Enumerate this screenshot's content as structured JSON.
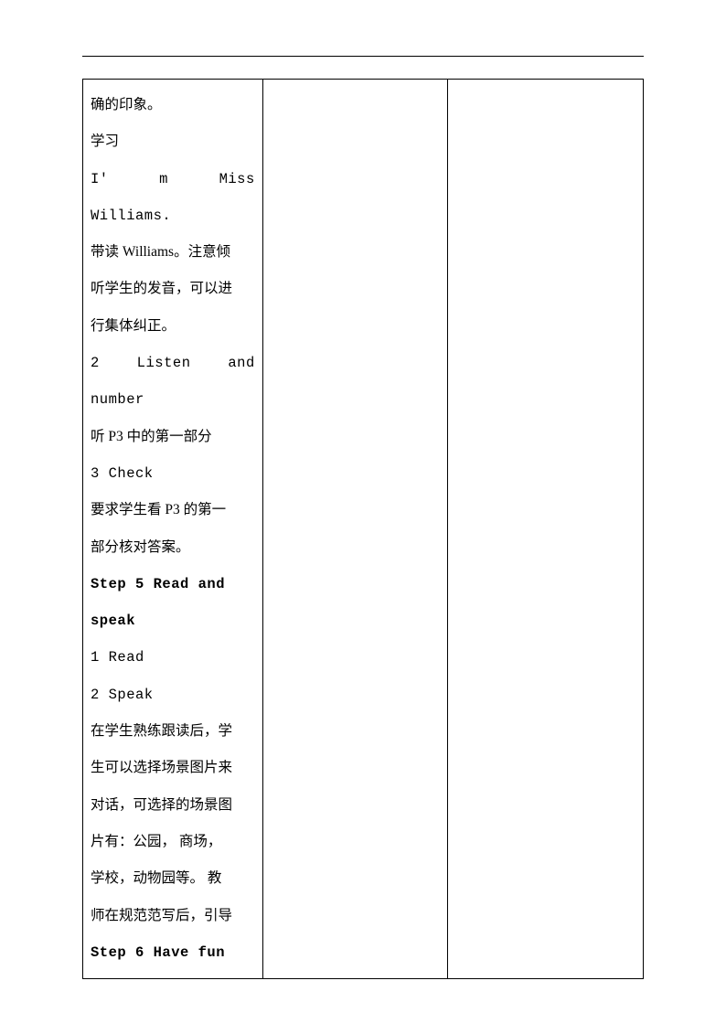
{
  "cell1": {
    "lines": [
      {
        "text": "确的印象。",
        "class": "line"
      },
      {
        "text": "学习",
        "class": "line"
      },
      {
        "text": "I' m Miss Williams.",
        "class": "line mono"
      },
      {
        "text": "带读 Williams。注意倾",
        "class": "line"
      },
      {
        "text": "听学生的发音，可以进",
        "class": "line"
      },
      {
        "text": "行集体纠正。",
        "class": "line"
      },
      {
        "text": "2 Listen and number",
        "class": "line mono"
      },
      {
        "text": "听 P3 中的第一部分",
        "class": "line"
      },
      {
        "text": "3 Check",
        "class": "line mono"
      },
      {
        "text": "要求学生看 P3 的第一",
        "class": "line"
      },
      {
        "text": "部分核对答案。",
        "class": "line"
      },
      {
        "text": "Step 5 Read and",
        "class": "line mono bold"
      },
      {
        "text": "speak",
        "class": "line mono bold"
      },
      {
        "text": "1 Read",
        "class": "line mono"
      },
      {
        "text": "2 Speak",
        "class": "line mono"
      },
      {
        "text": "在学生熟练跟读后，学",
        "class": "line"
      },
      {
        "text": "生可以选择场景图片来",
        "class": "line"
      },
      {
        "text": "对话，可选择的场景图",
        "class": "line"
      },
      {
        "text": "片有：公园， 商场，",
        "class": "line"
      },
      {
        "text": "学校，动物园等。 教",
        "class": "line"
      },
      {
        "text": "师在规范范写后，引导",
        "class": "line"
      },
      {
        "text": "Step 6 Have fun",
        "class": "line mono bold"
      }
    ]
  },
  "cell2": {
    "lines": []
  },
  "cell3": {
    "lines": []
  }
}
